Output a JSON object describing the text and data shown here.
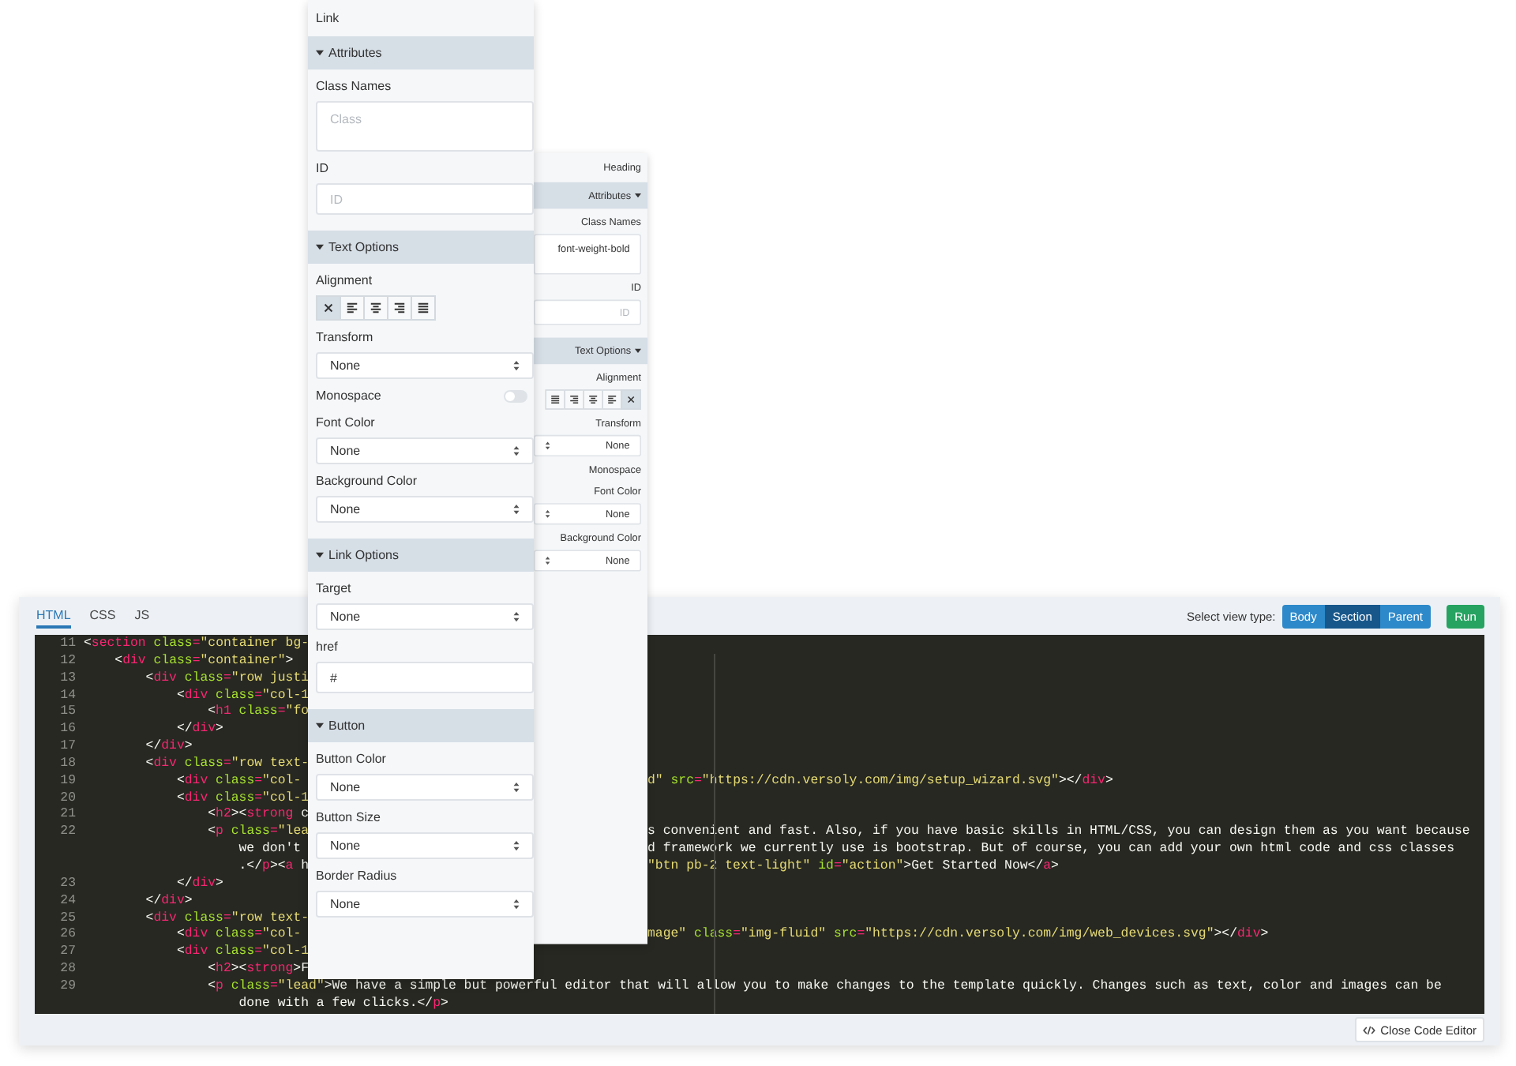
{
  "editor": {
    "tabs": [
      {
        "label": "HTML",
        "selected": true
      },
      {
        "label": "CSS",
        "selected": false
      },
      {
        "label": "JS",
        "selected": false
      }
    ],
    "view_type_label": "Select view type:",
    "view_types": [
      {
        "label": "Body",
        "selected": false
      },
      {
        "label": "Section",
        "selected": true
      },
      {
        "label": "Parent",
        "selected": false
      }
    ],
    "run_button": "Run",
    "code_lines": [
      {
        "number": "11",
        "left": "<section class=\"container bg-"
      },
      {
        "number": "12",
        "left": "    <div class=\"container\">"
      },
      {
        "number": "13",
        "left": "        <div class=\"row justi"
      },
      {
        "number": "14",
        "left": "            <div class=\"col-1"
      },
      {
        "number": "15",
        "left": "                <h1 class=\"fo"
      },
      {
        "number": "16",
        "left": "            </div>"
      },
      {
        "number": "17",
        "left": "        </div>"
      },
      {
        "number": "18",
        "left": "        <div class=\"row text-"
      },
      {
        "number": "19",
        "left": "            <div class=\"col-",
        "right": "d\" src=\"https://cdn.versoly.com/img/setup_wizard.svg\"></div>"
      },
      {
        "number": "20",
        "left": "            <div class=\"col-1"
      },
      {
        "number": "21",
        "left": "                <h2><strong c"
      },
      {
        "number": "22",
        "left": "                <p class=\"lea",
        "right": "s convenient and fast. Also, if you have basic skills in HTML/CSS, you can design them as you want because"
      },
      {
        "left": "                    we don't",
        "right": "d framework we currently use is bootstrap. But of course, you can add your own html code and css classes"
      },
      {
        "left": "                    .</p><a h",
        "right": "\"btn pb-2 text-light\" id=\"action\">Get Started Now</a>"
      },
      {
        "number": "23",
        "left": "            </div>"
      },
      {
        "number": "24",
        "left": "        </div>"
      },
      {
        "number": "25",
        "left": "        <div class=\"row text-"
      },
      {
        "number": "26",
        "left": "            <div class=\"col-",
        "right": "mage\" class=\"img-fluid\" src=\"https://cdn.versoly.com/img/web_devices.svg\"></div>"
      },
      {
        "number": "27",
        "left": "            <div class=\"col-1"
      },
      {
        "number": "28",
        "left": "                <h2><strong>F"
      },
      {
        "number": "29",
        "left": "                <p class=\"lead\">We have a simple but powerful editor that will allow you to make changes to the template quickly. Changes such as text, color and images can be"
      },
      {
        "left": "                    done with a few clicks.</p>"
      }
    ],
    "close_button": "Close Code Editor"
  },
  "panels": [
    {
      "title": "Link",
      "mirrored": false,
      "sections": [
        {
          "title": "Attributes",
          "expanded": true,
          "fields": [
            {
              "kind": "textarea",
              "label": "Class Names",
              "placeholder": "Class"
            },
            {
              "kind": "input",
              "label": "ID",
              "placeholder": "ID"
            }
          ]
        },
        {
          "title": "Text Options",
          "expanded": true,
          "fields": [
            {
              "kind": "alignment",
              "label": "Alignment",
              "options": [
                {
                  "kind": "none",
                  "selected": true
                },
                {
                  "kind": "left",
                  "selected": false
                },
                {
                  "kind": "center",
                  "selected": false
                },
                {
                  "kind": "right",
                  "selected": false
                },
                {
                  "kind": "justify",
                  "selected": false
                }
              ]
            },
            {
              "kind": "select",
              "label": "Transform",
              "value": "None"
            },
            {
              "kind": "toggle",
              "label": "Monospace",
              "on": false
            },
            {
              "kind": "select",
              "label": "Font Color",
              "value": "None"
            },
            {
              "kind": "select",
              "label": "Background Color",
              "value": "None"
            }
          ]
        },
        {
          "title": "Link Options",
          "expanded": true,
          "fields": [
            {
              "kind": "select",
              "label": "Target",
              "value": "None"
            },
            {
              "kind": "input",
              "label": "href",
              "value": "#"
            }
          ]
        },
        {
          "title": "Button",
          "expanded": true,
          "fields": [
            {
              "kind": "select",
              "label": "Button Color",
              "value": "None"
            },
            {
              "kind": "select",
              "label": "Button Size",
              "value": "None"
            },
            {
              "kind": "select",
              "label": "Border Radius",
              "value": "None"
            }
          ]
        }
      ]
    },
    {
      "title": "Heading",
      "mirrored": true,
      "sections": [
        {
          "title": "Attributes",
          "expanded": true,
          "fields": [
            {
              "kind": "textarea",
              "label": "Class Names",
              "value": "font-weight-bold"
            },
            {
              "kind": "input",
              "label": "ID",
              "placeholder": "ID"
            }
          ]
        },
        {
          "title": "Text Options",
          "expanded": true,
          "fields": [
            {
              "kind": "alignment",
              "label": "Alignment",
              "options": [
                {
                  "kind": "none",
                  "selected": true
                },
                {
                  "kind": "left",
                  "selected": false
                },
                {
                  "kind": "center",
                  "selected": false
                },
                {
                  "kind": "right",
                  "selected": false
                },
                {
                  "kind": "justify",
                  "selected": false
                }
              ]
            },
            {
              "kind": "select",
              "label": "Transform",
              "value": "None"
            },
            {
              "kind": "text",
              "label": "Monospace"
            },
            {
              "kind": "select",
              "label": "Font Color",
              "value": "None"
            },
            {
              "kind": "select",
              "label": "Background Color",
              "value": "None"
            }
          ]
        }
      ]
    }
  ]
}
